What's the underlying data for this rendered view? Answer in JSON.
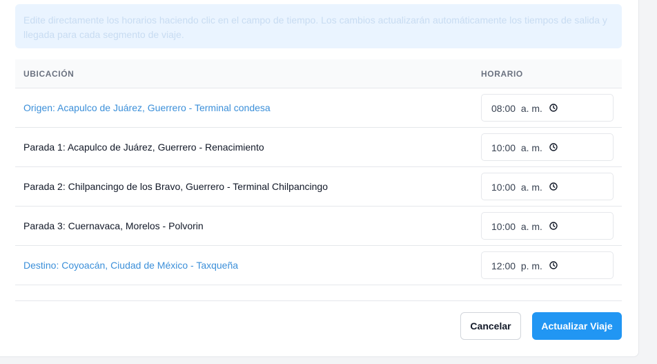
{
  "info_text": "Edite directamente los horarios haciendo clic en el campo de tiempo. Los cambios actualizarán automáticamente los tiempos de salida y llegada para cada segmento de viaje.",
  "table": {
    "headers": {
      "location": "UBICACIÓN",
      "time": "HORARIO"
    },
    "rows": [
      {
        "location": "Origen: Acapulco de Juárez, Guerrero - Terminal condesa",
        "time": "08:00  a. m.",
        "highlight": true
      },
      {
        "location": "Parada 1: Acapulco de Juárez, Guerrero - Renacimiento",
        "time": "10:00  a. m.",
        "highlight": false
      },
      {
        "location": "Parada 2: Chilpancingo de los Bravo, Guerrero - Terminal Chilpancingo",
        "time": "10:00  a. m.",
        "highlight": false
      },
      {
        "location": "Parada 3: Cuernavaca, Morelos - Polvorin",
        "time": "10:00  a. m.",
        "highlight": false
      },
      {
        "location": "Destino: Coyoacán, Ciudad de México - Taxqueña",
        "time": "12:00  p. m.",
        "highlight": true
      }
    ],
    "time_icon": "clock-icon"
  },
  "actions": {
    "cancel_label": "Cancelar",
    "update_label": "Actualizar Viaje"
  },
  "colors": {
    "accent": "#2196f3",
    "link": "#3b8fd9",
    "info_bg": "#eaf4ff"
  }
}
